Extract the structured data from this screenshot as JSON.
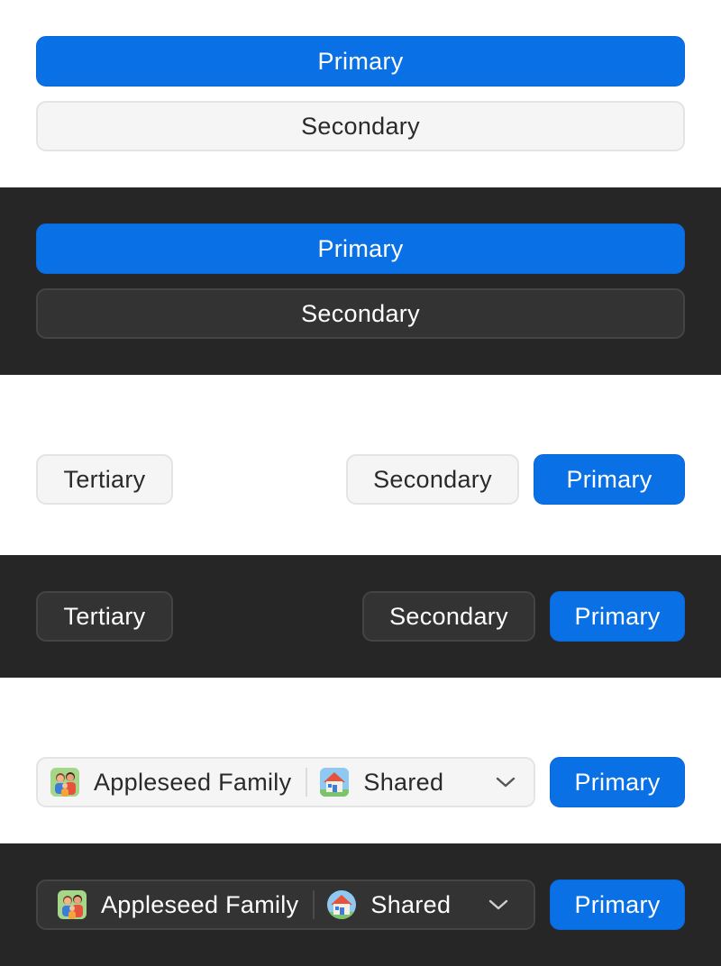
{
  "sections": {
    "block1": {
      "primary_label": "Primary",
      "secondary_label": "Secondary"
    },
    "block2": {
      "primary_label": "Primary",
      "secondary_label": "Secondary"
    },
    "row3": {
      "tertiary_label": "Tertiary",
      "secondary_label": "Secondary",
      "primary_label": "Primary"
    },
    "row4": {
      "tertiary_label": "Tertiary",
      "secondary_label": "Secondary",
      "primary_label": "Primary"
    },
    "row5": {
      "account_icon": "family-avatar-icon",
      "account_label": "Appleseed Family",
      "library_icon": "house-icon",
      "library_label": "Shared",
      "dropdown_icon": "chevron-down-icon",
      "primary_label": "Primary"
    },
    "row6": {
      "account_icon": "family-avatar-icon",
      "account_label": "Appleseed Family",
      "library_icon": "house-icon",
      "library_label": "Shared",
      "dropdown_icon": "chevron-down-icon",
      "primary_label": "Primary"
    }
  },
  "colors": {
    "accent": "#0a70e6",
    "dark_background": "#262626",
    "light_background": "#ffffff",
    "light_secondary_fill": "#f5f5f5",
    "dark_secondary_fill": "#333333"
  }
}
